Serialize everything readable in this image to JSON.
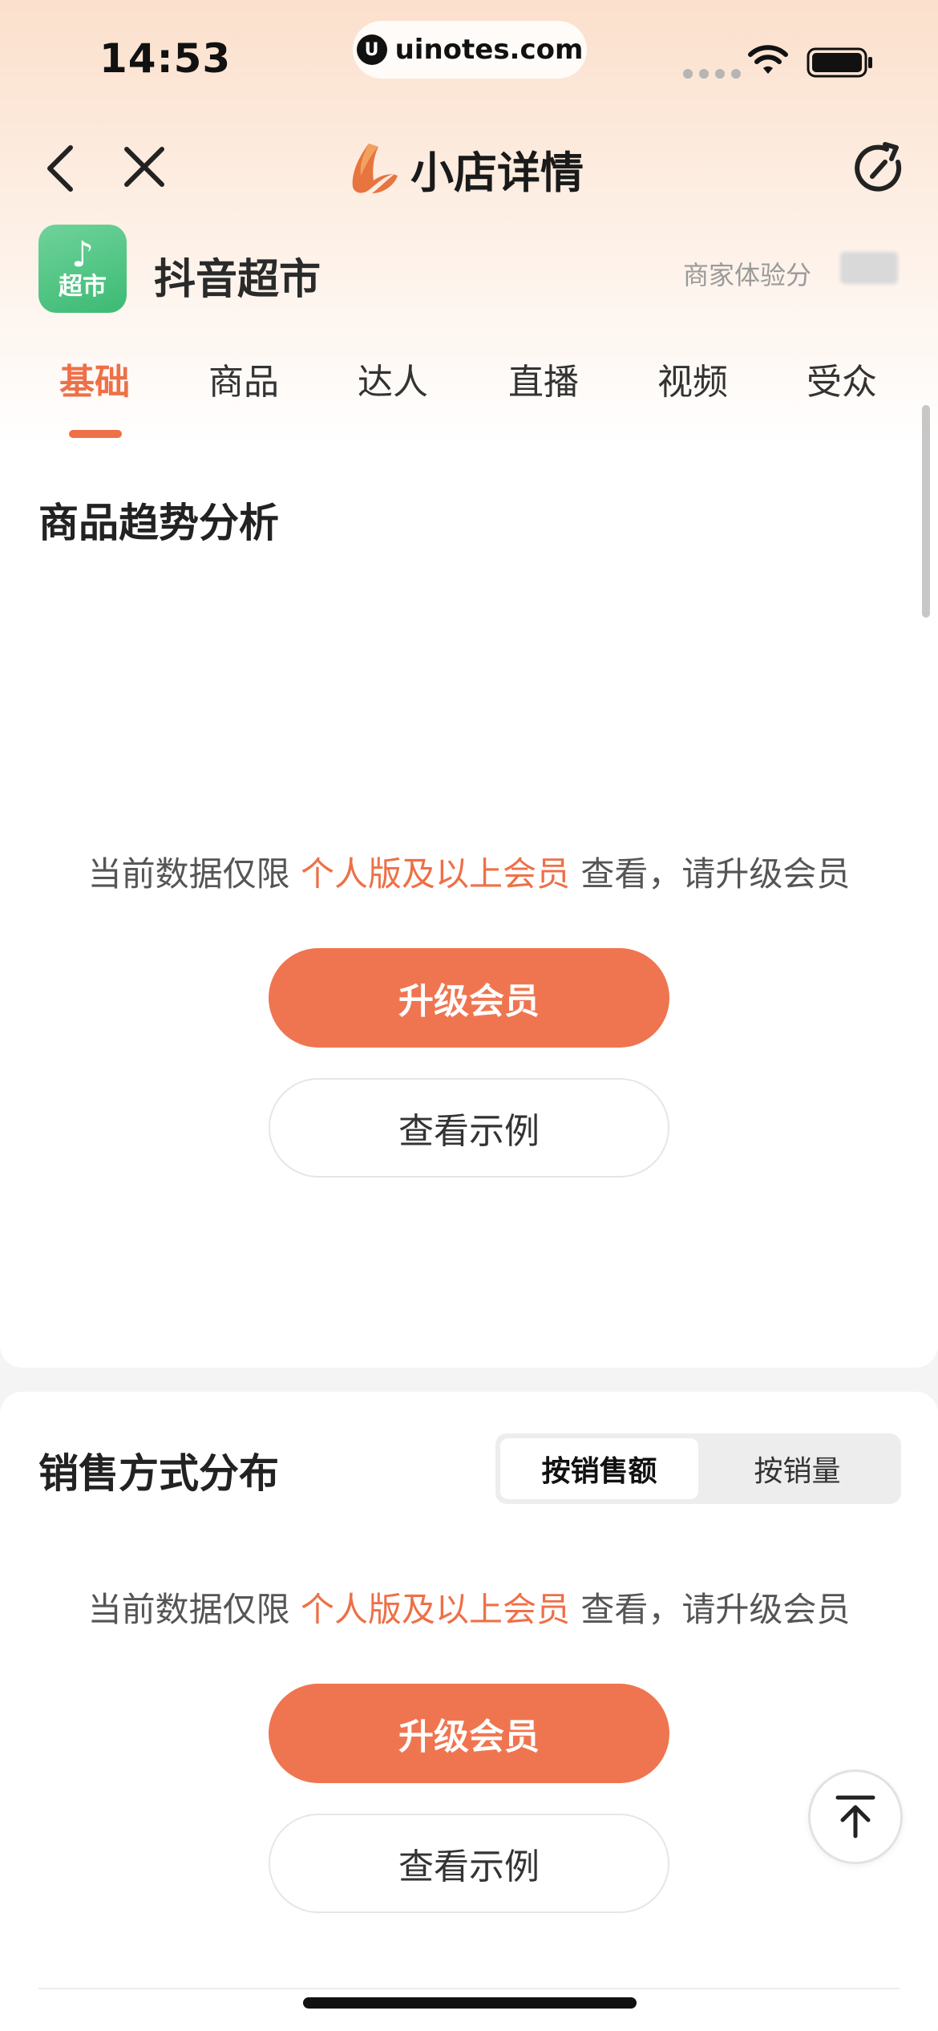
{
  "status_bar": {
    "time": "14:53",
    "url": "uinotes.com"
  },
  "nav": {
    "title": "小店详情"
  },
  "store": {
    "name": "抖音超市",
    "logo_text": "超市",
    "experience_label": "商家体验分",
    "experience_value": ""
  },
  "tabs": [
    {
      "label": "基础",
      "active": true
    },
    {
      "label": "商品",
      "active": false
    },
    {
      "label": "达人",
      "active": false
    },
    {
      "label": "直播",
      "active": false
    },
    {
      "label": "视频",
      "active": false
    },
    {
      "label": "受众",
      "active": false
    }
  ],
  "section_trend": {
    "title": "商品趋势分析",
    "notice_pre": "当前数据仅限",
    "notice_highlight": "个人版及以上会员",
    "notice_post": "查看，请升级会员",
    "upgrade_label": "升级会员",
    "example_label": "查看示例"
  },
  "section_sales": {
    "title": "销售方式分布",
    "toggle": {
      "by_amount": "按销售额",
      "by_volume": "按销量",
      "selected": "按销售额"
    },
    "notice_pre": "当前数据仅限",
    "notice_highlight": "个人版及以上会员",
    "notice_post": "查看，请升级会员",
    "upgrade_label": "升级会员",
    "example_label": "查看示例"
  },
  "colors": {
    "accent": "#ee7048",
    "store_logo": "#3cba74"
  },
  "icons": {
    "back": "back-arrow-icon",
    "close": "close-icon",
    "brand": "brand-logo-icon",
    "refresh": "refresh-icon",
    "back_to_top": "arrow-up-to-top-icon"
  }
}
